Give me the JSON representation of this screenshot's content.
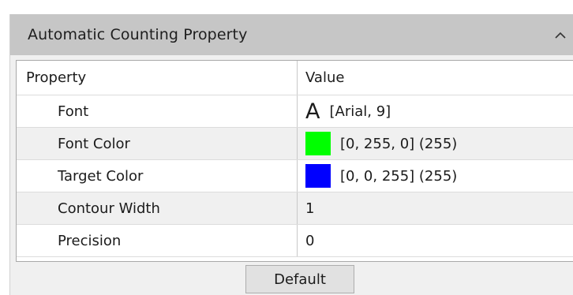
{
  "panel": {
    "title": "Automatic Counting Property",
    "collapse_icon": "chevron-up-icon"
  },
  "grid": {
    "headers": {
      "property": "Property",
      "value": "Value"
    },
    "rows": [
      {
        "name": "Font",
        "value": "[Arial, 9]",
        "icon": "font-glyph-icon",
        "glyph": "A"
      },
      {
        "name": "Font Color",
        "value": "[0, 255, 0] (255)",
        "swatch": "#00ff00"
      },
      {
        "name": "Target Color",
        "value": "[0, 0, 255] (255)",
        "swatch": "#0000ff"
      },
      {
        "name": "Contour Width",
        "value": "1"
      },
      {
        "name": "Precision",
        "value": "0"
      }
    ]
  },
  "buttons": {
    "default_label": "Default"
  },
  "colors": {
    "header_bg": "#c6c6c6",
    "panel_bg": "#f0f0f0",
    "alt_row_bg": "#f0f0f0"
  }
}
